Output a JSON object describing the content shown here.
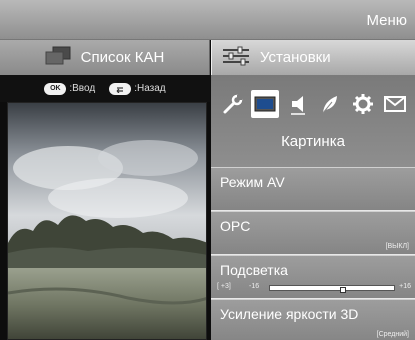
{
  "header": {
    "title": "Меню"
  },
  "tabs": [
    {
      "label": "Список КАН",
      "icon": "tv-list-icon",
      "active": false
    },
    {
      "label": "Установки",
      "icon": "sliders-icon",
      "active": true
    }
  ],
  "hints": {
    "ok_key": "OK",
    "ok_label": ":Ввод",
    "back_label": ":Назад"
  },
  "categories": {
    "icons": [
      "wrench-icon",
      "picture-icon",
      "speaker-icon",
      "leaf-icon",
      "gear-icon",
      "envelope-icon"
    ],
    "selected_index": 1,
    "selected_label": "Картинка"
  },
  "settings": {
    "items": [
      {
        "label": "Режим AV",
        "value": ""
      },
      {
        "label": "OPC",
        "value": "[ВЫКЛ]"
      },
      {
        "label": "Подсветка",
        "slider": {
          "current": "[ +3]",
          "min_label": "-16",
          "max_label": "+16",
          "value": 3,
          "min": -16,
          "max": 16
        }
      },
      {
        "label": "Усиление яркости 3D",
        "value": "[Средний]"
      }
    ]
  },
  "colors": {
    "active_tab": "#c9c9c9",
    "panel_item": "#919191"
  }
}
